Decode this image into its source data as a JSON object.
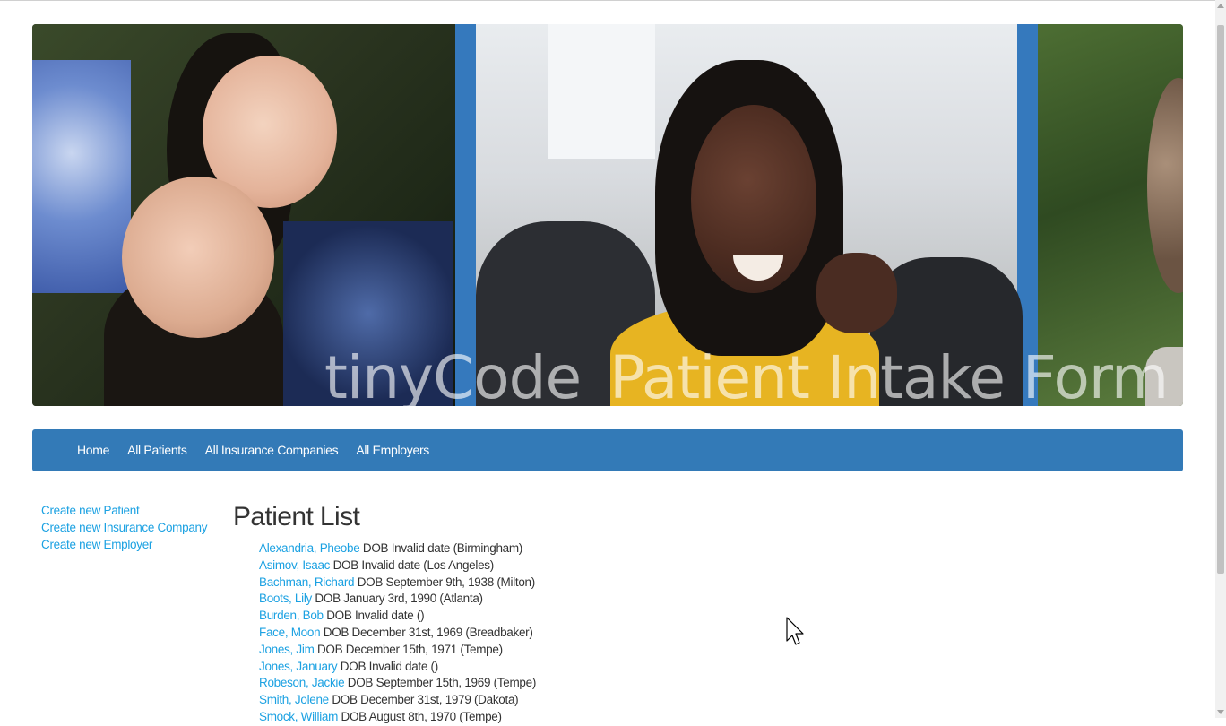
{
  "banner": {
    "title": "tinyCode_Patient Intake Form"
  },
  "nav": {
    "items": [
      {
        "label": "Home"
      },
      {
        "label": "All Patients"
      },
      {
        "label": "All Insurance Companies"
      },
      {
        "label": "All Employers"
      }
    ]
  },
  "sidebar": {
    "links": [
      {
        "label": "Create new Patient"
      },
      {
        "label": "Create new Insurance Company"
      },
      {
        "label": "Create new Employer"
      }
    ]
  },
  "main": {
    "heading": "Patient List",
    "patients": [
      {
        "name": "Alexandria, Pheobe",
        "details": " DOB Invalid date (Birmingham)"
      },
      {
        "name": "Asimov, Isaac",
        "details": " DOB Invalid date (Los Angeles)"
      },
      {
        "name": "Bachman, Richard",
        "details": " DOB September 9th, 1938 (Milton)"
      },
      {
        "name": "Boots, Lily",
        "details": " DOB January 3rd, 1990 (Atlanta)"
      },
      {
        "name": "Burden, Bob",
        "details": " DOB Invalid date ()"
      },
      {
        "name": "Face, Moon",
        "details": " DOB December 31st, 1969 (Breadbaker)"
      },
      {
        "name": "Jones, Jim",
        "details": " DOB December 15th, 1971 (Tempe)"
      },
      {
        "name": "Jones, January",
        "details": " DOB Invalid date ()"
      },
      {
        "name": "Robeson, Jackie",
        "details": " DOB September 15th, 1969 (Tempe)"
      },
      {
        "name": "Smith, Jolene",
        "details": " DOB December 31st, 1979 (Dakota)"
      },
      {
        "name": "Smock, William",
        "details": " DOB August 8th, 1970 (Tempe)"
      }
    ]
  },
  "colors": {
    "navbar_bg": "#337ab7",
    "link": "#1ba1e2",
    "text": "#333333"
  }
}
